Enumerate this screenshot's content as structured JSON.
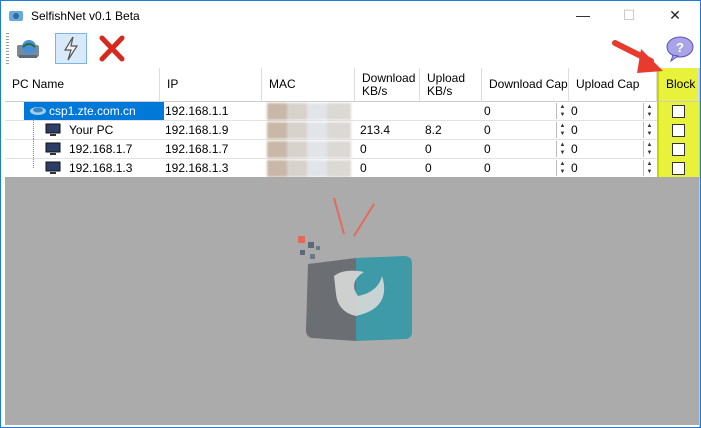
{
  "window": {
    "title": "SelfishNet v0.1 Beta",
    "controls": [
      "—",
      "☐",
      "✕"
    ]
  },
  "toolbar": {
    "buttons": [
      "network",
      "lightning",
      "stop"
    ],
    "help": "help"
  },
  "table": {
    "columns": [
      "PC Name",
      "IP",
      "MAC",
      "Download\nKB/s",
      "Upload\nKB/s",
      "Download Cap",
      "Upload Cap",
      "Block"
    ],
    "rows": [
      {
        "name": "csp1.zte.com.cn",
        "ip": "192.168.1.1",
        "download": "",
        "upload": "",
        "dl_cap": "0",
        "ul_cap": "0"
      },
      {
        "name": "Your PC",
        "ip": "192.168.1.9",
        "download": "213.4",
        "upload": "8.2",
        "dl_cap": "0",
        "ul_cap": "0"
      },
      {
        "name": "192.168.1.7",
        "ip": "192.168.1.7",
        "download": "0",
        "upload": "0",
        "dl_cap": "0",
        "ul_cap": "0"
      },
      {
        "name": "192.168.1.3",
        "ip": "192.168.1.3",
        "download": "0",
        "upload": "0",
        "dl_cap": "0",
        "ul_cap": "0"
      }
    ]
  },
  "colors": {
    "accent": "#0078d7",
    "block_highlight": "#e8f23a",
    "arrow": "#e63b2e",
    "panel_gray": "#ababab"
  }
}
